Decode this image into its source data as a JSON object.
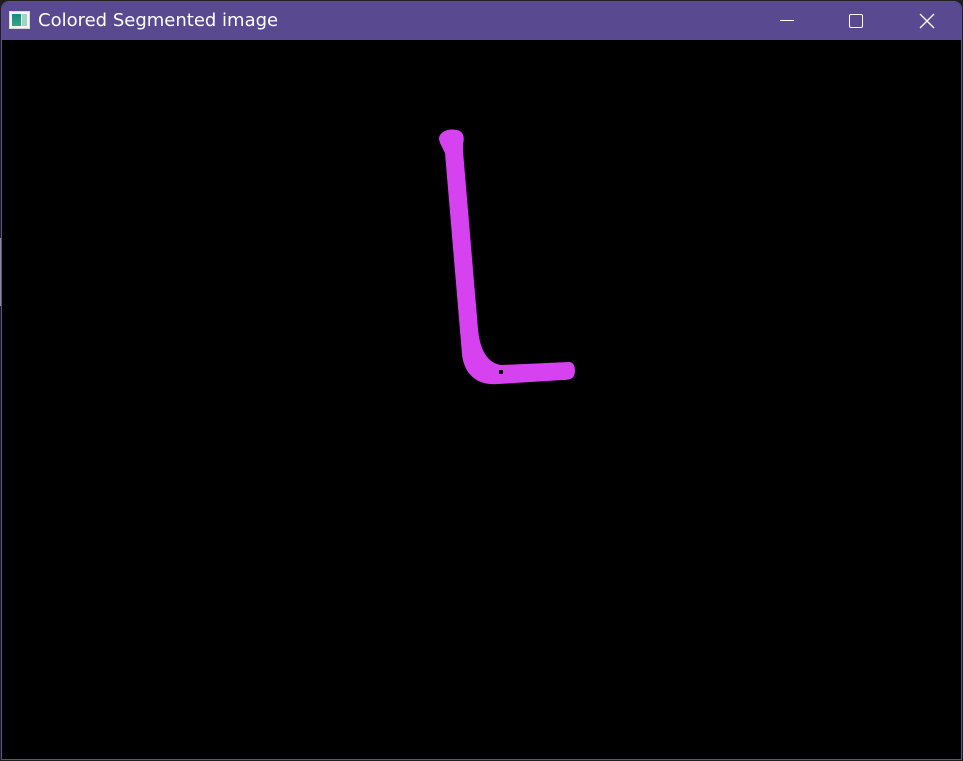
{
  "window": {
    "title": "Colored Segmented image",
    "colors": {
      "titlebar": "#584990",
      "canvas_background": "#000000",
      "segment": "#d642ef"
    }
  },
  "titlebar": {
    "app_icon": "window-app-icon",
    "controls": [
      {
        "name": "minimize-icon"
      },
      {
        "name": "maximize-icon"
      },
      {
        "name": "close-icon"
      }
    ]
  },
  "image": {
    "segments": [
      {
        "label": "",
        "shape": "L-shaped magenta segmented stroke"
      }
    ]
  }
}
